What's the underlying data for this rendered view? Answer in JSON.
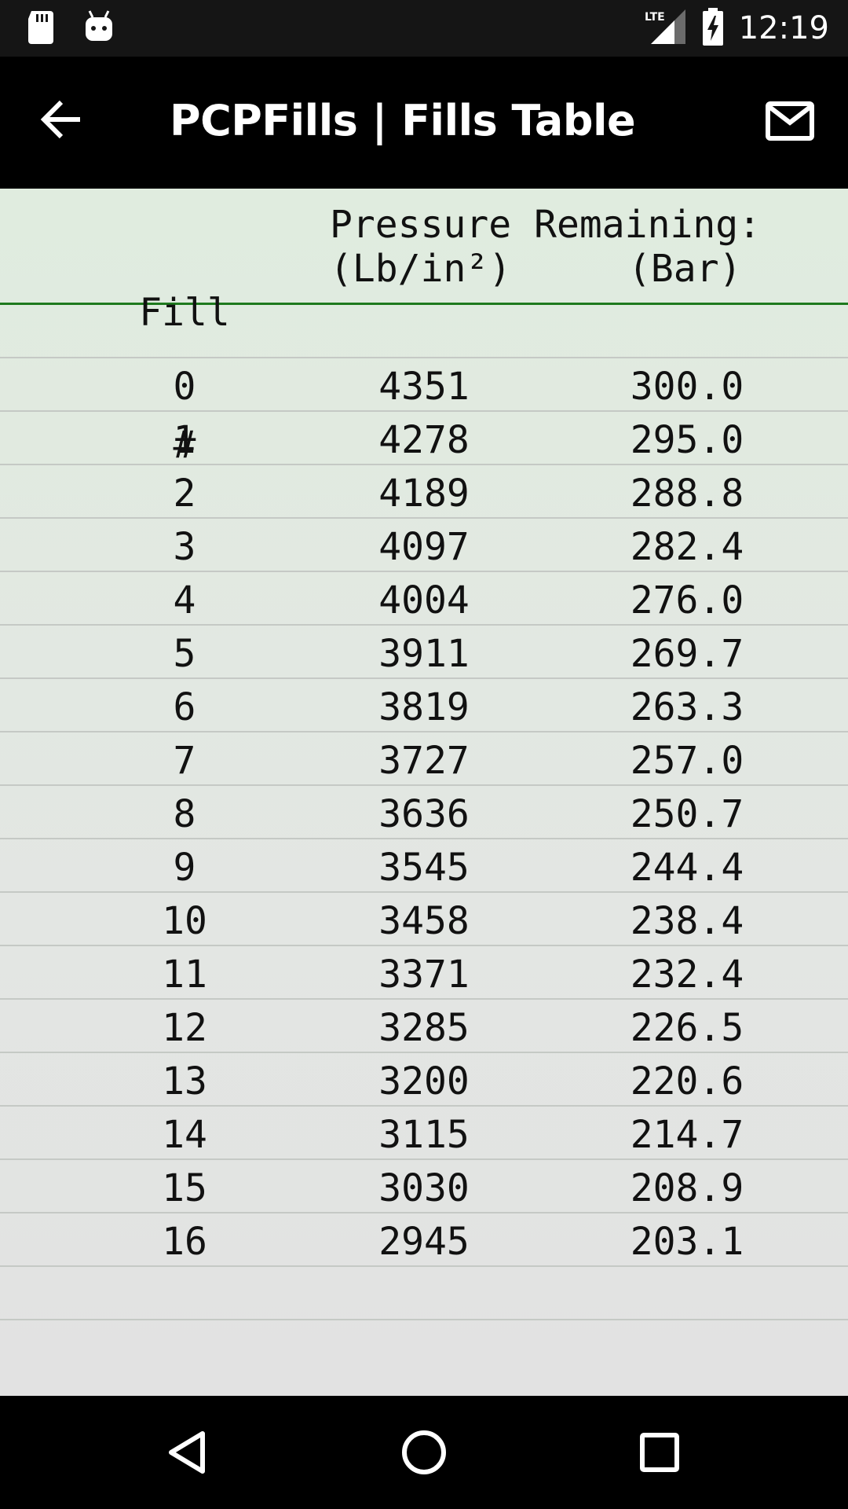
{
  "status_bar": {
    "time": "12:19",
    "network": "LTE",
    "icons": [
      "sd-card-icon",
      "android-icon",
      "signal-icon",
      "battery-charging-icon"
    ]
  },
  "app_bar": {
    "title": "PCPFills | Fills Table",
    "back_icon": "arrow-back-icon",
    "mail_icon": "mail-icon"
  },
  "table": {
    "header": {
      "fill_line1": "Fill",
      "fill_line2": "#",
      "pressure_title": "Pressure Remaining:",
      "psi_unit": "(Lb/in²)",
      "bar_unit": "(Bar)"
    },
    "rows": [
      {
        "fill": "0",
        "psi": "4351",
        "bar": "300.0"
      },
      {
        "fill": "1",
        "psi": "4278",
        "bar": "295.0"
      },
      {
        "fill": "2",
        "psi": "4189",
        "bar": "288.8"
      },
      {
        "fill": "3",
        "psi": "4097",
        "bar": "282.4"
      },
      {
        "fill": "4",
        "psi": "4004",
        "bar": "276.0"
      },
      {
        "fill": "5",
        "psi": "3911",
        "bar": "269.7"
      },
      {
        "fill": "6",
        "psi": "3819",
        "bar": "263.3"
      },
      {
        "fill": "7",
        "psi": "3727",
        "bar": "257.0"
      },
      {
        "fill": "8",
        "psi": "3636",
        "bar": "250.7"
      },
      {
        "fill": "9",
        "psi": "3545",
        "bar": "244.4"
      },
      {
        "fill": "10",
        "psi": "3458",
        "bar": "238.4"
      },
      {
        "fill": "11",
        "psi": "3371",
        "bar": "232.4"
      },
      {
        "fill": "12",
        "psi": "3285",
        "bar": "226.5"
      },
      {
        "fill": "13",
        "psi": "3200",
        "bar": "220.6"
      },
      {
        "fill": "14",
        "psi": "3115",
        "bar": "214.7"
      },
      {
        "fill": "15",
        "psi": "3030",
        "bar": "208.9"
      },
      {
        "fill": "16",
        "psi": "2945",
        "bar": "203.1"
      }
    ]
  },
  "nav_bar": {
    "icons": [
      "nav-back-icon",
      "nav-home-icon",
      "nav-recents-icon"
    ]
  },
  "colors": {
    "header_divider": "#1e7a1e",
    "content_bg": "#e0ecdf",
    "app_bar_bg": "#000000"
  }
}
